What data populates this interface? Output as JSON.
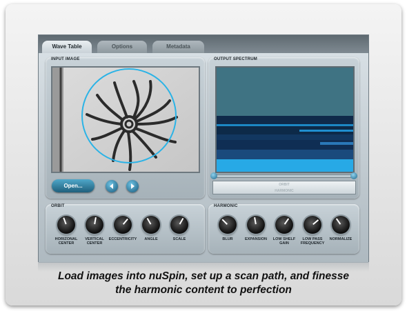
{
  "tabs": [
    {
      "label": "Wave Table",
      "active": true
    },
    {
      "label": "Options",
      "active": false
    },
    {
      "label": "Metadata",
      "active": false
    }
  ],
  "input_panel": {
    "title": "INPUT IMAGE",
    "open_button": "Open...",
    "prev_icon": "left-arrow-icon",
    "next_icon": "right-arrow-icon"
  },
  "output_panel": {
    "title": "OUTPUT SPECTRUM",
    "mode_orbit": "ORBIT",
    "mode_harmonic": "HARMONIC"
  },
  "orbit_panel": {
    "title": "ORBIT",
    "knobs": [
      "HORIZONAL\nCENTER",
      "VERTICAL\nCENTER",
      "ECCENTRICITY",
      "ANGLE",
      "SCALE"
    ]
  },
  "harmonic_panel": {
    "title": "HARMONIC",
    "knobs": [
      "BLUR",
      "EXPANSION",
      "LOW SHELF\nGAIN",
      "LOW PASS\nFREQUENCY",
      "NORMALIZE"
    ]
  },
  "caption": {
    "line1": "Load images into nuSpin, set up a scan path, and finesse",
    "line2": "the harmonic content to perfection"
  },
  "colors": {
    "accent": "#2bb3e6",
    "spectrum_bg": "#2e5460"
  }
}
